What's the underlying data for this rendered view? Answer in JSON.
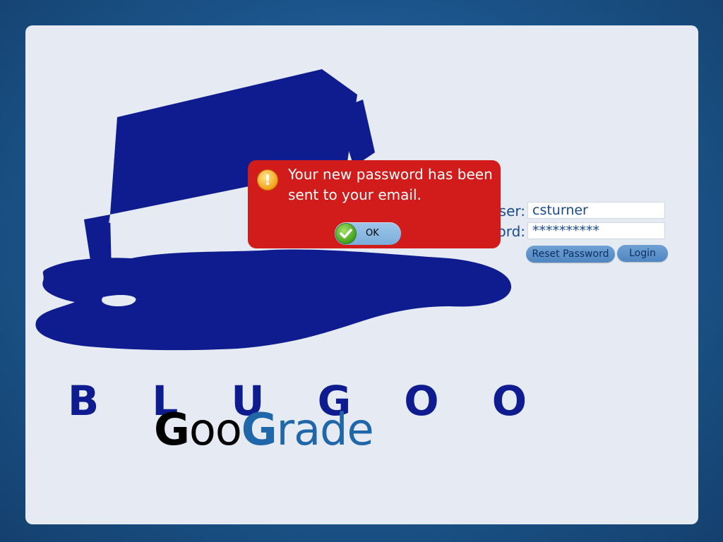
{
  "brand": {
    "logo_word": "BLUGOO",
    "logo_letters": [
      "B",
      "L",
      "U",
      "G",
      "O",
      "O"
    ],
    "product_g1": "G",
    "product_part1": "oo",
    "product_g2": "G",
    "product_part2": "rade",
    "logo_color": "#0e1c8f",
    "accent": "#1f67a8"
  },
  "login": {
    "user_label": "User:",
    "password_label": "Password:",
    "user_value": "csturner",
    "password_value": "**********",
    "reset_button": "Reset Password",
    "login_button": "Login"
  },
  "alert": {
    "icon": "warning-icon",
    "message": "Your new password has been sent to your email.",
    "ok_label": "OK",
    "ok_icon": "check-icon",
    "background": "#d21c1c"
  }
}
